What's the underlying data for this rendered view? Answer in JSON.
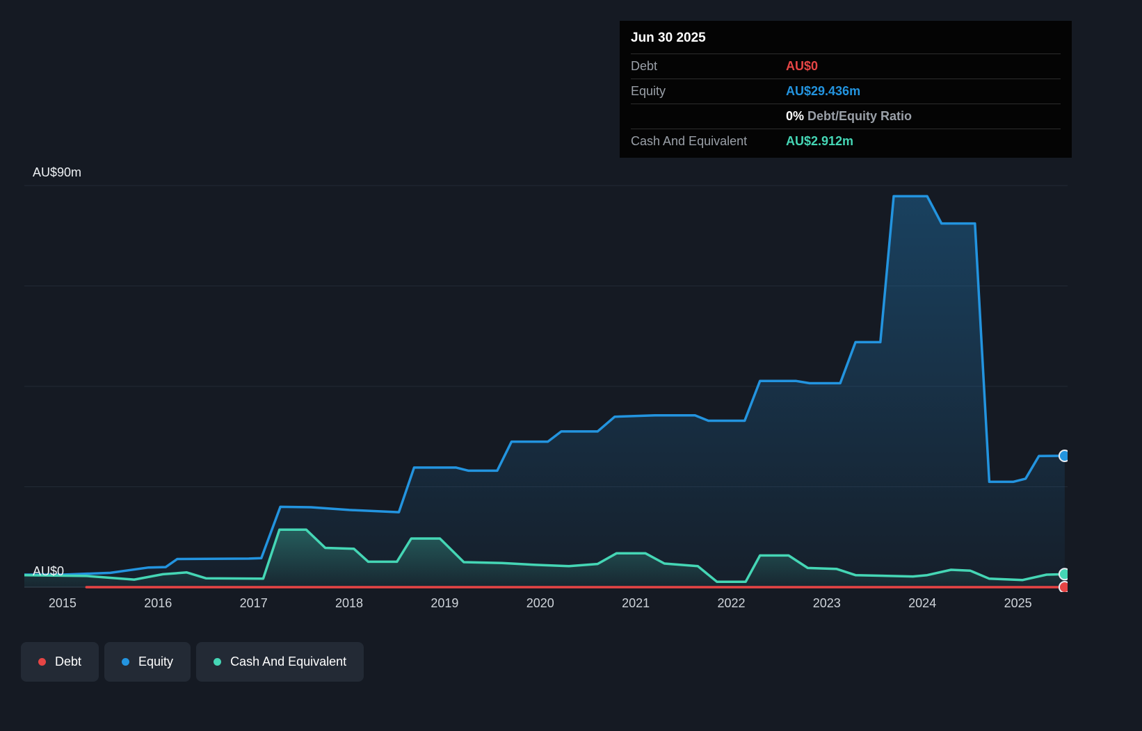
{
  "colors": {
    "background": "#151a23",
    "tooltip_bg": "#040404",
    "debt": "#e64545",
    "equity": "#2394df",
    "cash": "#45d6b5",
    "grid": "#222a35",
    "baseline": "#39424e"
  },
  "tooltip": {
    "date": "Jun 30 2025",
    "rows": {
      "debt": {
        "label": "Debt",
        "value": "AU$0"
      },
      "equity": {
        "label": "Equity",
        "value": "AU$29.436m"
      },
      "ratio": {
        "value": "0%",
        "label": "Debt/Equity Ratio"
      },
      "cash": {
        "label": "Cash And Equivalent",
        "value": "AU$2.912m"
      }
    }
  },
  "axis": {
    "y_top_label": "AU$90m",
    "y_zero_label": "AU$0",
    "x_ticks": [
      "2015",
      "2016",
      "2017",
      "2018",
      "2019",
      "2020",
      "2021",
      "2022",
      "2023",
      "2024",
      "2025"
    ]
  },
  "legend": [
    {
      "label": "Debt",
      "color": "#e64545"
    },
    {
      "label": "Equity",
      "color": "#2394df"
    },
    {
      "label": "Cash And Equivalent",
      "color": "#45d6b5"
    }
  ],
  "chart_data": {
    "type": "area",
    "ylabel": "AU$m",
    "xlim": [
      2014.6,
      2025.52
    ],
    "ylim": [
      0,
      90
    ],
    "y_gridlines": [
      0,
      22.5,
      45,
      67.5,
      90
    ],
    "grid": true,
    "legend_position": "bottom-left",
    "series": [
      {
        "name": "Equity",
        "color": "#2394df",
        "fill": true,
        "x": [
          2014.6,
          2015.0,
          2015.5,
          2015.9,
          2016.08,
          2016.2,
          2016.95,
          2017.08,
          2017.28,
          2017.6,
          2018.0,
          2018.52,
          2018.68,
          2019.12,
          2019.25,
          2019.55,
          2019.7,
          2020.08,
          2020.22,
          2020.6,
          2020.78,
          2021.2,
          2021.62,
          2021.76,
          2022.14,
          2022.3,
          2022.68,
          2022.82,
          2023.14,
          2023.3,
          2023.56,
          2023.7,
          2024.05,
          2024.2,
          2024.55,
          2024.7,
          2024.95,
          2025.08,
          2025.22,
          2025.49
        ],
        "y": [
          2.8,
          2.8,
          3.2,
          4.4,
          4.5,
          6.3,
          6.4,
          6.5,
          18.0,
          17.9,
          17.3,
          16.8,
          26.8,
          26.8,
          26.1,
          26.1,
          32.6,
          32.6,
          34.9,
          34.9,
          38.2,
          38.5,
          38.5,
          37.3,
          37.3,
          46.2,
          46.2,
          45.7,
          45.7,
          54.9,
          54.9,
          87.6,
          87.6,
          81.5,
          81.5,
          23.6,
          23.6,
          24.3,
          29.4,
          29.436
        ]
      },
      {
        "name": "Cash And Equivalent",
        "color": "#45d6b5",
        "fill": true,
        "x": [
          2014.6,
          2015.25,
          2015.75,
          2016.05,
          2016.3,
          2016.5,
          2017.1,
          2017.27,
          2017.55,
          2017.75,
          2018.05,
          2018.2,
          2018.5,
          2018.65,
          2018.95,
          2019.2,
          2019.6,
          2019.95,
          2020.3,
          2020.6,
          2020.8,
          2021.1,
          2021.3,
          2021.65,
          2021.85,
          2022.15,
          2022.3,
          2022.6,
          2022.8,
          2023.1,
          2023.3,
          2023.9,
          2024.05,
          2024.3,
          2024.5,
          2024.7,
          2025.05,
          2025.3,
          2025.49
        ],
        "y": [
          2.7,
          2.5,
          1.7,
          2.9,
          3.3,
          2.0,
          1.9,
          12.9,
          12.9,
          8.8,
          8.6,
          5.7,
          5.7,
          10.9,
          10.9,
          5.6,
          5.4,
          5.0,
          4.7,
          5.2,
          7.6,
          7.6,
          5.3,
          4.7,
          1.2,
          1.2,
          7.1,
          7.1,
          4.3,
          4.1,
          2.7,
          2.4,
          2.7,
          3.9,
          3.7,
          1.9,
          1.6,
          2.8,
          2.912
        ]
      },
      {
        "name": "Debt",
        "color": "#e64545",
        "fill": false,
        "x": [
          2015.25,
          2025.49
        ],
        "y": [
          0,
          0
        ]
      }
    ]
  }
}
